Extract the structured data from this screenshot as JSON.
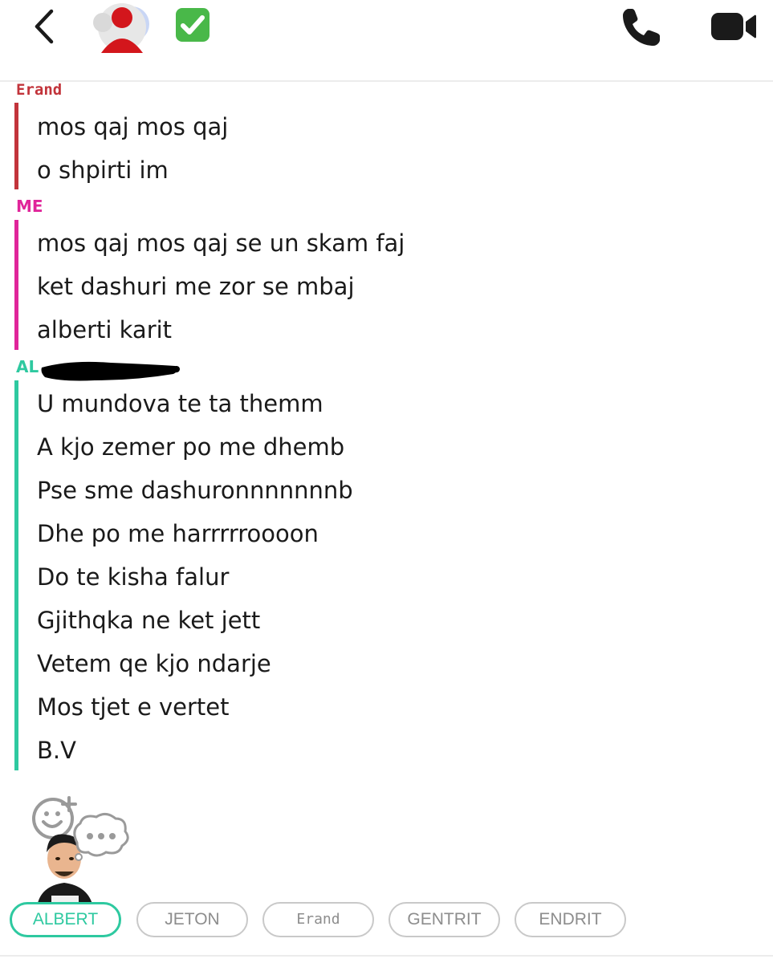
{
  "header": {
    "back_icon": "chevron-left-icon",
    "avatar_icon": "group-avatar-icon",
    "verified_icon": "check-mark-button-emoji",
    "call_icon": "phone-icon",
    "video_icon": "video-camera-icon"
  },
  "colors": {
    "erand": "#c2343b",
    "me": "#e0259a",
    "albert": "#2ec9a0",
    "chip_border": "#c9c9c9",
    "chip_text": "#8d8d8d"
  },
  "groups": [
    {
      "sender": "Erand",
      "messages": [
        "mos qaj mos qaj",
        "o shpirti im"
      ]
    },
    {
      "sender": "ME",
      "messages": [
        "mos qaj mos qaj se un skam faj",
        "ket dashuri me zor se mbaj",
        "alberti karit"
      ]
    },
    {
      "sender": "AL",
      "messages": [
        "U mundova te ta themm",
        "A kjo zemer po me dhemb",
        "Pse sme dashuronnnnnnnb",
        "Dhe po me harrrrroooon",
        "Do te kisha falur",
        "Gjithqka ne ket jett",
        "Vetem qe kjo ndarje",
        "Mos tjet e vertet",
        "B.V"
      ]
    }
  ],
  "bitmoji": {
    "add_reaction_icon": "smiley-plus-icon",
    "typing_icon": "typing-bubble-icon"
  },
  "chips": [
    "ALBERT",
    "JETON",
    "Erand",
    "GENTRIT",
    "ENDRIT"
  ],
  "active_chip": "ALBERT"
}
